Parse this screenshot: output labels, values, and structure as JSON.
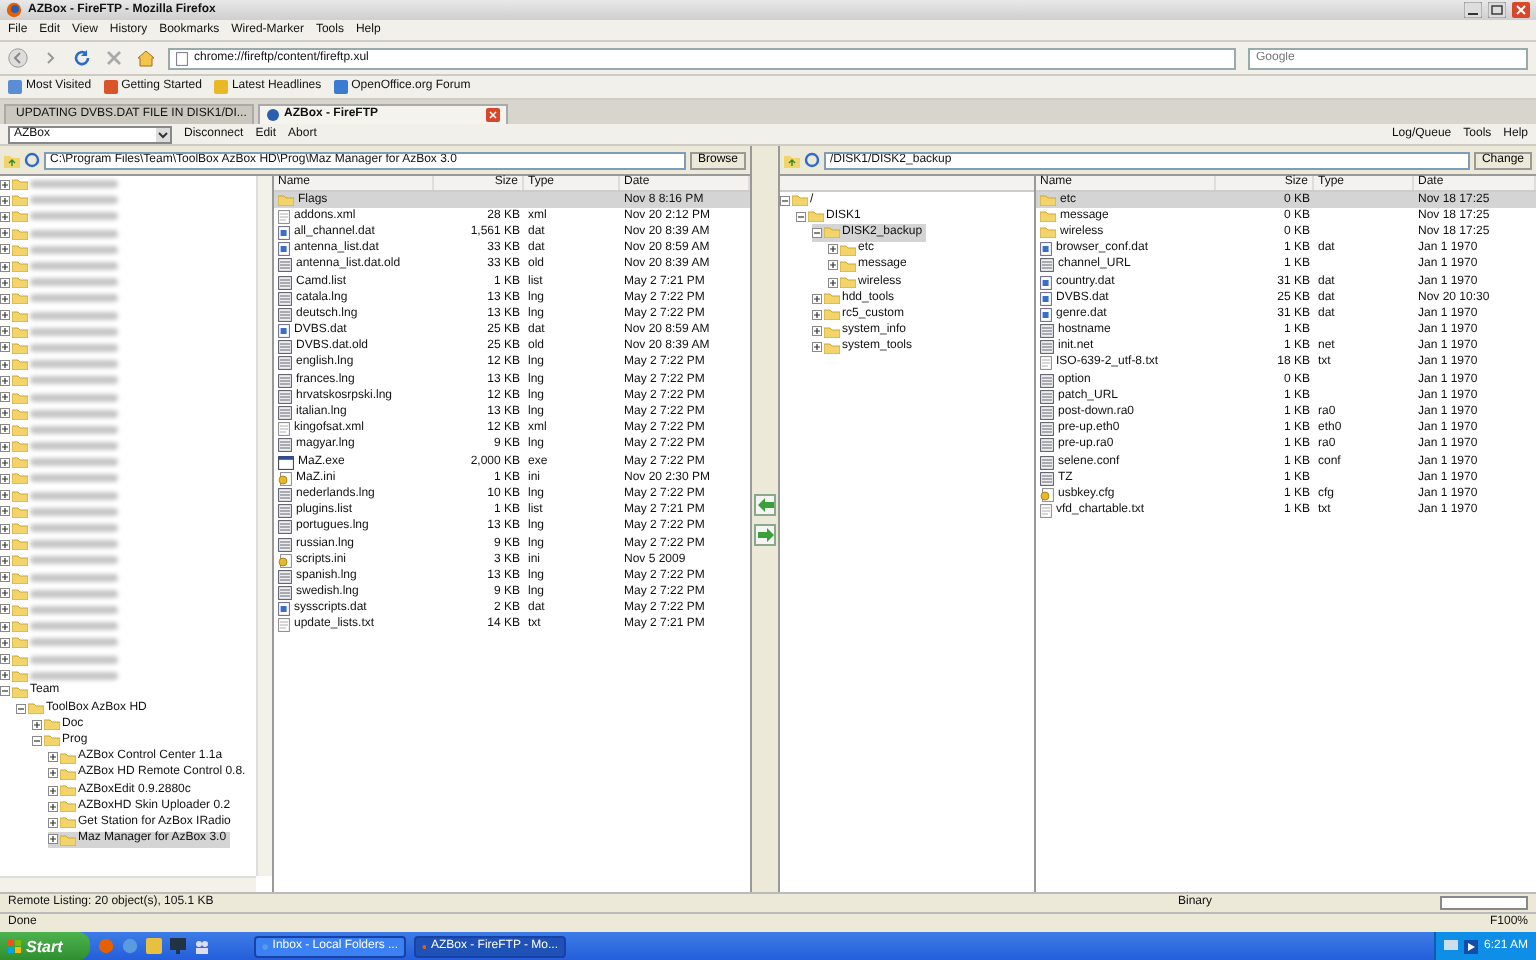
{
  "browser": {
    "title": "AZBox - FireFTP - Mozilla Firefox",
    "menu": [
      "File",
      "Edit",
      "View",
      "History",
      "Bookmarks",
      "Wired-Marker",
      "Tools",
      "Help"
    ],
    "url": "chrome://fireftp/content/fireftp.xul",
    "search": {
      "placeholder": "Google"
    },
    "bookmarks": [
      "Most Visited",
      "Getting Started",
      "Latest Headlines",
      "OpenOffice.org Forum"
    ],
    "tabs": [
      {
        "label": "UPDATING DVBS.DAT FILE IN DISK1/DI...",
        "selected": false
      },
      {
        "label": "AZBox - FireFTP",
        "selected": true
      }
    ]
  },
  "fireftp": {
    "account": "AZBox",
    "actions": [
      "Disconnect",
      "Edit",
      "Abort"
    ],
    "menu": [
      "Log/Queue",
      "Tools",
      "Help"
    ]
  },
  "local": {
    "path": "C:\\Program Files\\Team\\ToolBox AzBox HD\\Prog\\Maz Manager for AzBox 3.0",
    "browse_button": "Browse",
    "tree": [
      {
        "kind": "blurred"
      },
      {
        "kind": "blurred"
      },
      {
        "kind": "blurred"
      },
      {
        "kind": "blurred"
      },
      {
        "kind": "blurred"
      },
      {
        "kind": "blurred"
      },
      {
        "kind": "blurred"
      },
      {
        "kind": "blurred"
      },
      {
        "kind": "blurred"
      },
      {
        "kind": "blurred"
      },
      {
        "kind": "blurred"
      },
      {
        "kind": "blurred"
      },
      {
        "kind": "blurred"
      },
      {
        "kind": "blurred"
      },
      {
        "kind": "blurred"
      },
      {
        "kind": "blurred"
      },
      {
        "kind": "blurred"
      },
      {
        "kind": "blurred"
      },
      {
        "kind": "blurred"
      },
      {
        "kind": "blurred"
      },
      {
        "kind": "blurred"
      },
      {
        "kind": "blurred"
      },
      {
        "kind": "blurred"
      },
      {
        "kind": "blurred"
      },
      {
        "kind": "blurred"
      },
      {
        "kind": "blurred"
      },
      {
        "kind": "blurred"
      },
      {
        "kind": "blurred"
      },
      {
        "kind": "blurred"
      },
      {
        "kind": "blurred"
      },
      {
        "kind": "blurred"
      },
      {
        "kind": "folder",
        "label": "Team",
        "expanded": true,
        "selected": false,
        "children": [
          {
            "kind": "folder",
            "label": "ToolBox AzBox HD",
            "expanded": true,
            "selected": false,
            "children": [
              {
                "kind": "folder",
                "label": "Doc",
                "expanded": false,
                "selected": false
              },
              {
                "kind": "folder",
                "label": "Prog",
                "expanded": true,
                "selected": false,
                "children": [
                  {
                    "kind": "folder",
                    "label": "AZBox Control Center 1.1a",
                    "expanded": false,
                    "selected": false
                  },
                  {
                    "kind": "folder",
                    "label": "AZBox HD Remote Control 0.8.",
                    "expanded": false,
                    "selected": false
                  },
                  {
                    "kind": "folder",
                    "label": "AZBoxEdit 0.9.2880c",
                    "expanded": false,
                    "selected": false
                  },
                  {
                    "kind": "folder",
                    "label": "AZBoxHD Skin Uploader 0.2",
                    "expanded": false,
                    "selected": false
                  },
                  {
                    "kind": "folder",
                    "label": "Get Station for AzBox IRadio",
                    "expanded": false,
                    "selected": false
                  },
                  {
                    "kind": "folder",
                    "label": "Maz Manager for AzBox 3.0",
                    "expanded": false,
                    "selected": true
                  }
                ]
              }
            ]
          }
        ]
      }
    ],
    "columns": [
      "Name",
      "Size",
      "Type",
      "Date"
    ],
    "files": [
      {
        "kind": "folder",
        "name": "Flags",
        "date": "Nov 8 8:16 PM",
        "selected": true
      },
      {
        "kind": "doc",
        "name": "addons.xml",
        "size": "28 KB",
        "type": "xml",
        "date": "Nov 20 2:12 PM",
        "selected": false
      },
      {
        "kind": "data",
        "name": "all_channel.dat",
        "size": "1,561 KB",
        "type": "dat",
        "date": "Nov 20 8:39 AM",
        "selected": false
      },
      {
        "kind": "data",
        "name": "antenna_list.dat",
        "size": "33 KB",
        "type": "dat",
        "date": "Nov 20 8:59 AM",
        "selected": false
      },
      {
        "kind": "file",
        "name": "antenna_list.dat.old",
        "size": "33 KB",
        "type": "old",
        "date": "Nov 20 8:39 AM",
        "selected": false
      },
      {
        "kind": "file",
        "name": "Camd.list",
        "size": "1 KB",
        "type": "list",
        "date": "May 2 7:21 PM",
        "selected": false
      },
      {
        "kind": "file",
        "name": "catala.lng",
        "size": "13 KB",
        "type": "lng",
        "date": "May 2 7:22 PM",
        "selected": false
      },
      {
        "kind": "file",
        "name": "deutsch.lng",
        "size": "13 KB",
        "type": "lng",
        "date": "May 2 7:22 PM",
        "selected": false
      },
      {
        "kind": "data",
        "name": "DVBS.dat",
        "size": "25 KB",
        "type": "dat",
        "date": "Nov 20 8:59 AM",
        "selected": false
      },
      {
        "kind": "file",
        "name": "DVBS.dat.old",
        "size": "25 KB",
        "type": "old",
        "date": "Nov 20 8:39 AM",
        "selected": false
      },
      {
        "kind": "file",
        "name": "english.lng",
        "size": "12 KB",
        "type": "lng",
        "date": "May 2 7:22 PM",
        "selected": false
      },
      {
        "kind": "file",
        "name": "frances.lng",
        "size": "13 KB",
        "type": "lng",
        "date": "May 2 7:22 PM",
        "selected": false
      },
      {
        "kind": "file",
        "name": "hrvatskosrpski.lng",
        "size": "12 KB",
        "type": "lng",
        "date": "May 2 7:22 PM",
        "selected": false
      },
      {
        "kind": "file",
        "name": "italian.lng",
        "size": "13 KB",
        "type": "lng",
        "date": "May 2 7:22 PM",
        "selected": false
      },
      {
        "kind": "doc",
        "name": "kingofsat.xml",
        "size": "12 KB",
        "type": "xml",
        "date": "May 2 7:22 PM",
        "selected": false
      },
      {
        "kind": "file",
        "name": "magyar.lng",
        "size": "9 KB",
        "type": "lng",
        "date": "May 2 7:22 PM",
        "selected": false
      },
      {
        "kind": "app",
        "name": "MaZ.exe",
        "size": "2,000 KB",
        "type": "exe",
        "date": "May 2 7:22 PM",
        "selected": false
      },
      {
        "kind": "config",
        "name": "MaZ.ini",
        "size": "1 KB",
        "type": "ini",
        "date": "Nov 20 2:30 PM",
        "selected": false
      },
      {
        "kind": "file",
        "name": "nederlands.lng",
        "size": "10 KB",
        "type": "lng",
        "date": "May 2 7:22 PM",
        "selected": false
      },
      {
        "kind": "file",
        "name": "plugins.list",
        "size": "1 KB",
        "type": "list",
        "date": "May 2 7:21 PM",
        "selected": false
      },
      {
        "kind": "file",
        "name": "portugues.lng",
        "size": "13 KB",
        "type": "lng",
        "date": "May 2 7:22 PM",
        "selected": false
      },
      {
        "kind": "file",
        "name": "russian.lng",
        "size": "9 KB",
        "type": "lng",
        "date": "May 2 7:22 PM",
        "selected": false
      },
      {
        "kind": "config",
        "name": "scripts.ini",
        "size": "3 KB",
        "type": "ini",
        "date": "Nov 5 2009",
        "selected": false
      },
      {
        "kind": "file",
        "name": "spanish.lng",
        "size": "13 KB",
        "type": "lng",
        "date": "May 2 7:22 PM",
        "selected": false
      },
      {
        "kind": "file",
        "name": "swedish.lng",
        "size": "9 KB",
        "type": "lng",
        "date": "May 2 7:22 PM",
        "selected": false
      },
      {
        "kind": "data",
        "name": "sysscripts.dat",
        "size": "2 KB",
        "type": "dat",
        "date": "May 2 7:22 PM",
        "selected": false
      },
      {
        "kind": "doc",
        "name": "update_lists.txt",
        "size": "14 KB",
        "type": "txt",
        "date": "May 2 7:21 PM",
        "selected": false
      }
    ]
  },
  "remote": {
    "path": "/DISK1/DISK2_backup",
    "change_button": "Change",
    "tree": [
      {
        "kind": "folder",
        "label": "/",
        "expanded": true,
        "selected": false,
        "children": [
          {
            "kind": "folder",
            "label": "DISK1",
            "expanded": true,
            "selected": false,
            "children": [
              {
                "kind": "folder",
                "label": "DISK2_backup",
                "expanded": true,
                "selected": true,
                "children": [
                  {
                    "kind": "folder",
                    "label": "etc",
                    "expanded": false,
                    "selected": false
                  },
                  {
                    "kind": "folder",
                    "label": "message",
                    "expanded": false,
                    "selected": false
                  },
                  {
                    "kind": "folder",
                    "label": "wireless",
                    "expanded": false,
                    "selected": false
                  }
                ]
              },
              {
                "kind": "folder",
                "label": "hdd_tools",
                "expanded": false,
                "selected": false
              },
              {
                "kind": "folder",
                "label": "rc5_custom",
                "expanded": false,
                "selected": false
              },
              {
                "kind": "folder",
                "label": "system_info",
                "expanded": false,
                "selected": false
              },
              {
                "kind": "folder",
                "label": "system_tools",
                "expanded": false,
                "selected": false
              }
            ]
          }
        ]
      }
    ],
    "columns": [
      "Name",
      "Size",
      "Type",
      "Date"
    ],
    "files": [
      {
        "kind": "folder",
        "name": "etc",
        "size": "0 KB",
        "date": "Nov 18 17:25",
        "selected": true
      },
      {
        "kind": "folder",
        "name": "message",
        "size": "0 KB",
        "date": "Nov 18 17:25",
        "selected": false
      },
      {
        "kind": "folder",
        "name": "wireless",
        "size": "0 KB",
        "date": "Nov 18 17:25",
        "selected": false
      },
      {
        "kind": "data",
        "name": "browser_conf.dat",
        "size": "1 KB",
        "type": "dat",
        "date": "Jan 1 1970",
        "selected": false
      },
      {
        "kind": "file",
        "name": "channel_URL",
        "size": "1 KB",
        "date": "Jan 1 1970",
        "selected": false
      },
      {
        "kind": "data",
        "name": "country.dat",
        "size": "31 KB",
        "type": "dat",
        "date": "Jan 1 1970",
        "selected": false
      },
      {
        "kind": "data",
        "name": "DVBS.dat",
        "size": "25 KB",
        "type": "dat",
        "date": "Nov 20 10:30",
        "selected": false
      },
      {
        "kind": "data",
        "name": "genre.dat",
        "size": "31 KB",
        "type": "dat",
        "date": "Jan 1 1970",
        "selected": false
      },
      {
        "kind": "file",
        "name": "hostname",
        "size": "1 KB",
        "date": "Jan 1 1970",
        "selected": false
      },
      {
        "kind": "file",
        "name": "init.net",
        "size": "1 KB",
        "type": "net",
        "date": "Jan 1 1970",
        "selected": false
      },
      {
        "kind": "doc",
        "name": "ISO-639-2_utf-8.txt",
        "size": "18 KB",
        "type": "txt",
        "date": "Jan 1 1970",
        "selected": false
      },
      {
        "kind": "file",
        "name": "option",
        "size": "0 KB",
        "date": "Jan 1 1970",
        "selected": false
      },
      {
        "kind": "file",
        "name": "patch_URL",
        "size": "1 KB",
        "date": "Jan 1 1970",
        "selected": false
      },
      {
        "kind": "file",
        "name": "post-down.ra0",
        "size": "1 KB",
        "type": "ra0",
        "date": "Jan 1 1970",
        "selected": false
      },
      {
        "kind": "file",
        "name": "pre-up.eth0",
        "size": "1 KB",
        "type": "eth0",
        "date": "Jan 1 1970",
        "selected": false
      },
      {
        "kind": "file",
        "name": "pre-up.ra0",
        "size": "1 KB",
        "type": "ra0",
        "date": "Jan 1 1970",
        "selected": false
      },
      {
        "kind": "file",
        "name": "selene.conf",
        "size": "1 KB",
        "type": "conf",
        "date": "Jan 1 1970",
        "selected": false
      },
      {
        "kind": "file",
        "name": "TZ",
        "size": "1 KB",
        "date": "Jan 1 1970",
        "selected": false
      },
      {
        "kind": "config",
        "name": "usbkey.cfg",
        "size": "1 KB",
        "type": "cfg",
        "date": "Jan 1 1970",
        "selected": false
      },
      {
        "kind": "doc",
        "name": "vfd_chartable.txt",
        "size": "1 KB",
        "type": "txt",
        "date": "Jan 1 1970",
        "selected": false
      }
    ]
  },
  "status": {
    "listing": "Remote Listing: 20 object(s), 105.1 KB",
    "mode": "Binary",
    "progress": {
      "level": 0
    },
    "state": "Done",
    "zoom": "F100%"
  },
  "taskbar": {
    "start": "Start",
    "windows": [
      {
        "label": "Inbox - Local Folders ...",
        "selected": false
      },
      {
        "label": "AZBox - FireFTP - Mo...",
        "selected": true
      }
    ],
    "clock": "6:21 AM"
  }
}
